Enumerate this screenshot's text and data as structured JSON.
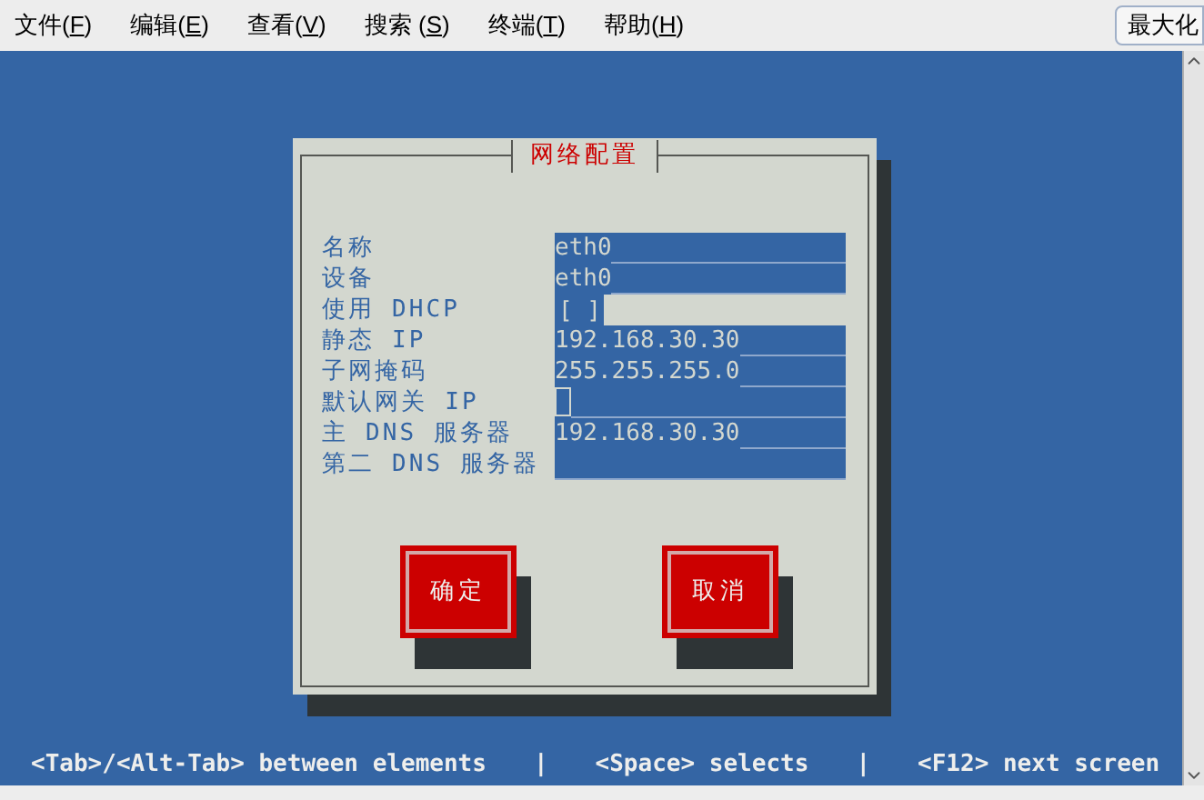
{
  "menu": [
    {
      "prefix": "文件(",
      "key": "F",
      "suffix": ")"
    },
    {
      "prefix": "编辑(",
      "key": "E",
      "suffix": ")"
    },
    {
      "prefix": "查看(",
      "key": "V",
      "suffix": ")"
    },
    {
      "prefix": "搜索 (",
      "key": "S",
      "suffix": ")"
    },
    {
      "prefix": "终端(",
      "key": "T",
      "suffix": ")"
    },
    {
      "prefix": "帮助(",
      "key": "H",
      "suffix": ")"
    }
  ],
  "maximize_button": "最大化",
  "dialog": {
    "title": "网络配置",
    "fields": [
      {
        "label": "名称",
        "kind": "text",
        "value": "eth0",
        "focused": false
      },
      {
        "label": "设备",
        "kind": "text",
        "value": "eth0",
        "focused": false
      },
      {
        "label": "使用 DHCP",
        "kind": "checkbox",
        "value": "[ ]",
        "focused": false
      },
      {
        "label": "静态 IP",
        "kind": "text",
        "value": "192.168.30.30",
        "focused": false
      },
      {
        "label": "子网掩码",
        "kind": "text",
        "value": "255.255.255.0",
        "focused": false
      },
      {
        "label": "默认网关 IP",
        "kind": "text",
        "focused": true
      },
      {
        "label": "主 DNS 服务器",
        "kind": "text",
        "value": "192.168.30.30",
        "focused": false
      },
      {
        "label": "第二 DNS 服务器",
        "kind": "text",
        "focused": false
      }
    ],
    "buttons": [
      "确定",
      "取消"
    ]
  },
  "status_bar": [
    "<Tab>/<Alt-Tab> between elements",
    "|",
    "<Space> selects",
    "|",
    "<F12> next screen"
  ]
}
